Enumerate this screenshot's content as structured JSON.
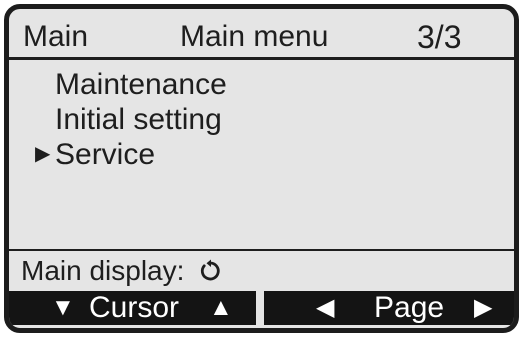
{
  "header": {
    "left": "Main",
    "title": "Main menu",
    "page": "3/3"
  },
  "menu": {
    "items": [
      {
        "label": "Maintenance",
        "selected": false
      },
      {
        "label": "Initial setting",
        "selected": false
      },
      {
        "label": "Service",
        "selected": true
      }
    ]
  },
  "status": {
    "label": "Main display:",
    "icon": "return-arrow-icon"
  },
  "softkeys": {
    "cursor": {
      "label": "Cursor",
      "icon_left": "triangle-down-icon",
      "icon_right": "triangle-up-icon"
    },
    "page": {
      "label": "Page",
      "icon_left": "triangle-left-icon",
      "icon_right": "triangle-right-icon"
    }
  }
}
